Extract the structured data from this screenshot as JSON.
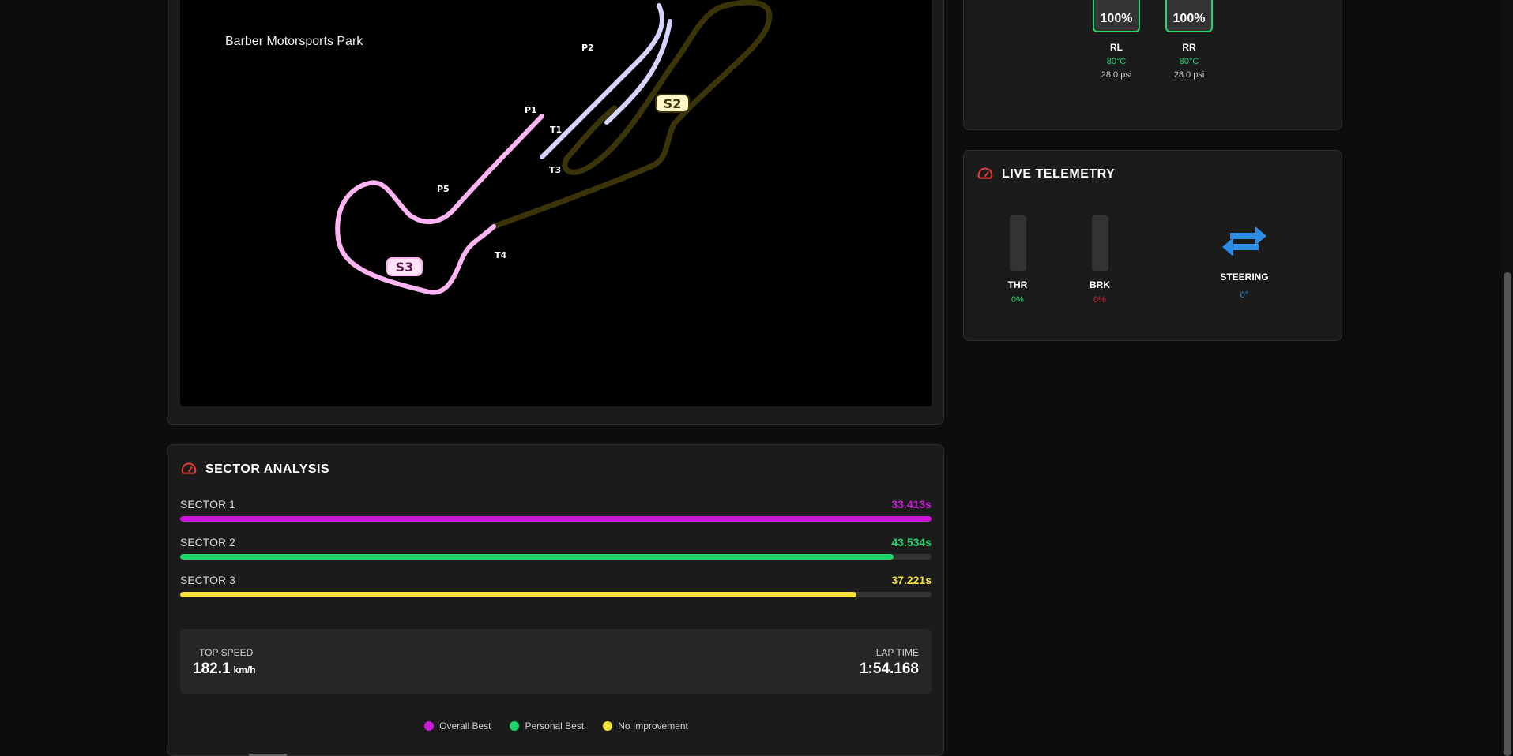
{
  "track_map": {
    "name": "Barber Motorsports Park",
    "labels": {
      "p1": "P1",
      "p2": "P2",
      "p5": "P5",
      "t1": "T1",
      "t3": "T3",
      "t4": "T4",
      "s2": "S2",
      "s3": "S3"
    }
  },
  "sector_analysis": {
    "title": "SECTOR ANALYSIS",
    "sectors": [
      {
        "label": "SECTOR 1",
        "time": "33.413s",
        "fill": 1.0,
        "color": "#cc16d9"
      },
      {
        "label": "SECTOR 2",
        "time": "43.534s",
        "fill": 0.95,
        "color": "#1fd26a"
      },
      {
        "label": "SECTOR 3",
        "time": "37.221s",
        "fill": 0.9,
        "color": "#f5e23a"
      }
    ],
    "top_speed_label": "TOP SPEED",
    "top_speed_value": "182.1",
    "top_speed_unit": "km/h",
    "lap_time_label": "LAP TIME",
    "lap_time_value": "1:54.168",
    "legend": [
      {
        "label": "Overall Best",
        "color": "#cc16d9"
      },
      {
        "label": "Personal Best",
        "color": "#1fd26a"
      },
      {
        "label": "No Improvement",
        "color": "#f5e23a"
      }
    ]
  },
  "tires": [
    {
      "name": "RL",
      "wear": "100%",
      "temp": "80°C",
      "psi": "28.0 psi"
    },
    {
      "name": "RR",
      "wear": "100%",
      "temp": "80°C",
      "psi": "28.0 psi"
    }
  ],
  "telemetry": {
    "title": "LIVE TELEMETRY",
    "throttle_label": "THR",
    "throttle_value": "0%",
    "brake_label": "BRK",
    "brake_value": "0%",
    "steering_label": "STEERING",
    "steering_value": "0°",
    "colors": {
      "throttle": "#1fd26a",
      "brake": "#e0243c",
      "steering": "#2b8ce6",
      "accent": "#e53935"
    }
  }
}
